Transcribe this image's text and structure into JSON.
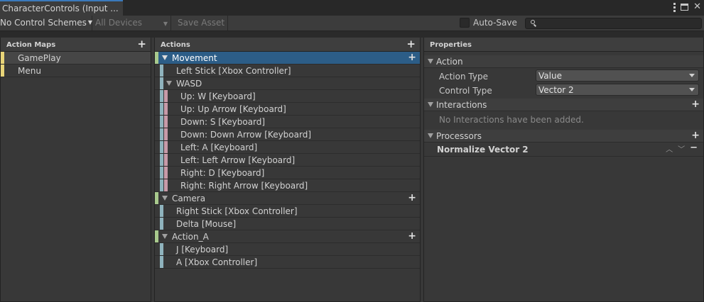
{
  "window": {
    "tab_title": "CharacterControls (Input ..."
  },
  "toolbar": {
    "control_schemes": "No Control Schemes",
    "devices": "All Devices",
    "save_asset": "Save Asset",
    "auto_save_label": "Auto-Save",
    "auto_save_checked": false,
    "search_placeholder": ""
  },
  "action_maps": {
    "header": "Action Maps",
    "items": [
      {
        "label": "GamePlay",
        "selected": true
      },
      {
        "label": "Menu",
        "selected": false
      }
    ]
  },
  "actions": {
    "header": "Actions",
    "rows": [
      {
        "label": "Movement",
        "kind": "action",
        "selected": true
      },
      {
        "label": "Left Stick [Xbox Controller]",
        "kind": "binding"
      },
      {
        "label": "WASD",
        "kind": "composite"
      },
      {
        "label": "Up: W [Keyboard]",
        "kind": "part"
      },
      {
        "label": "Up: Up Arrow [Keyboard]",
        "kind": "part"
      },
      {
        "label": "Down: S [Keyboard]",
        "kind": "part"
      },
      {
        "label": "Down: Down Arrow [Keyboard]",
        "kind": "part"
      },
      {
        "label": "Left: A [Keyboard]",
        "kind": "part"
      },
      {
        "label": "Left: Left Arrow [Keyboard]",
        "kind": "part"
      },
      {
        "label": "Right: D [Keyboard]",
        "kind": "part"
      },
      {
        "label": "Right: Right Arrow [Keyboard]",
        "kind": "part"
      },
      {
        "label": "Camera",
        "kind": "action"
      },
      {
        "label": "Right Stick [Xbox Controller]",
        "kind": "binding"
      },
      {
        "label": "Delta [Mouse]",
        "kind": "binding"
      },
      {
        "label": "Action_A",
        "kind": "action"
      },
      {
        "label": "J [Keyboard]",
        "kind": "binding"
      },
      {
        "label": "A [Xbox Controller]",
        "kind": "binding"
      }
    ]
  },
  "properties": {
    "header": "Properties",
    "action_section": "Action",
    "action_type_label": "Action Type",
    "action_type_value": "Value",
    "control_type_label": "Control Type",
    "control_type_value": "Vector 2",
    "interactions_section": "Interactions",
    "interactions_empty": "No Interactions have been added.",
    "processors_section": "Processors",
    "processor_name": "Normalize Vector 2"
  },
  "colors": {
    "action_map": "#e8d478",
    "action": "#a8c98d",
    "binding": "#8fb3bd",
    "part": "#c89aa8",
    "selection": "#2c5d87"
  }
}
